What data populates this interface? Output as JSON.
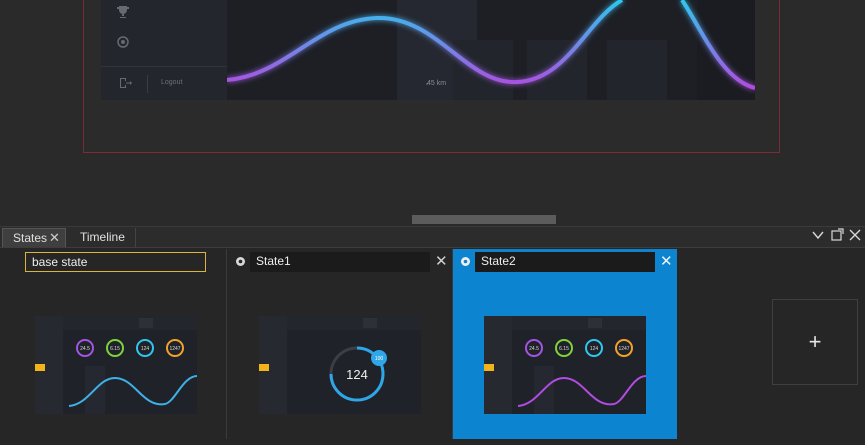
{
  "canvas": {
    "sidebar_icons": [
      "trophy-icon",
      "settings-circle-icon",
      "logout-icon"
    ],
    "logout_label": "Logout",
    "distance_label": "45 km"
  },
  "panel": {
    "tabs": [
      {
        "label": "States",
        "active": true
      },
      {
        "label": "Timeline",
        "active": false
      }
    ],
    "panel_buttons": [
      "chevron-down-icon",
      "undock-icon",
      "close-icon"
    ]
  },
  "states": [
    {
      "name": "base state",
      "selected": false,
      "editing": true
    },
    {
      "name": "State1",
      "selected": false
    },
    {
      "name": "State2",
      "selected": true
    }
  ],
  "thumbnails": {
    "base_stats": [
      "24.5",
      "6.15",
      "124",
      "1247"
    ],
    "s1_center_value": "124",
    "s1_badge": "100",
    "s2_stats": [
      "24.5",
      "6.15",
      "124",
      "1247"
    ]
  },
  "add_state_label": "+",
  "colors": {
    "selected_state": "#0c84d0",
    "editing_border": "#d9b53a",
    "artboard_border": "#7a2b3a",
    "wave_start": "#b04ce0",
    "wave_end": "#2ec7ee"
  }
}
